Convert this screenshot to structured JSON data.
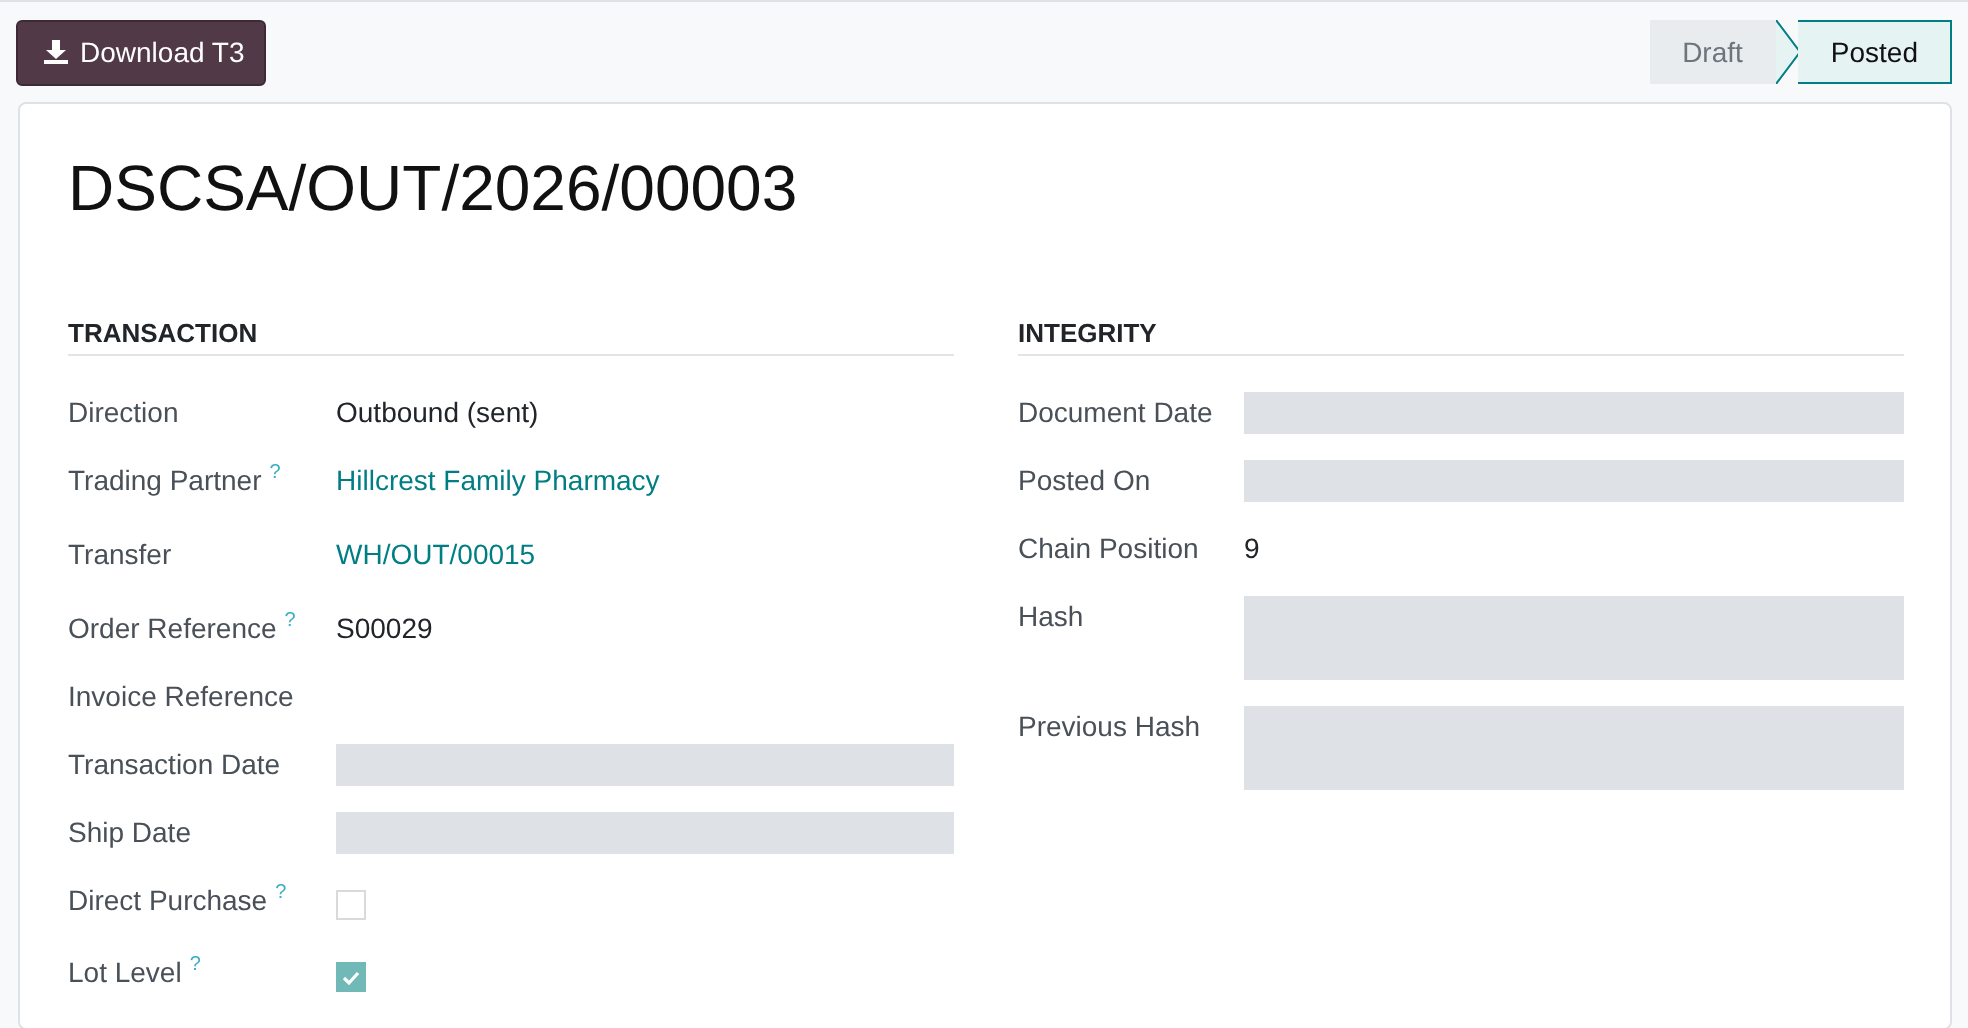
{
  "download_button": {
    "label": "Download T3"
  },
  "status": [
    {
      "label": "Draft",
      "selected": false
    },
    {
      "label": "Posted",
      "selected": true
    }
  ],
  "title": "DSCSA/OUT/2026/00003",
  "sections": [
    {
      "heading": "TRANSACTION",
      "fields": [
        {
          "label": "Direction",
          "kind": "text",
          "value": "Outbound (sent)"
        },
        {
          "label": "Trading Partner",
          "help": "?",
          "kind": "link",
          "value": "Hillcrest Family Pharmacy"
        },
        {
          "label": "Transfer",
          "kind": "link",
          "value": "WH/OUT/00015"
        },
        {
          "label": "Order Reference",
          "help": "?",
          "kind": "text",
          "value": "S00029"
        },
        {
          "label": "Invoice Reference",
          "kind": "empty"
        },
        {
          "label": "Transaction Date",
          "kind": "blank"
        },
        {
          "label": "Ship Date",
          "kind": "blank"
        },
        {
          "label": "Direct Purchase",
          "help": "?",
          "kind": "checkbox",
          "checked": false
        },
        {
          "label": "Lot Level",
          "help": "?",
          "kind": "checkbox",
          "checked": true
        }
      ]
    },
    {
      "heading": "INTEGRITY",
      "fields": [
        {
          "label": "Document Date",
          "kind": "blank"
        },
        {
          "label": "Posted On",
          "kind": "blank"
        },
        {
          "label": "Chain Position",
          "kind": "text",
          "value": "9"
        },
        {
          "label": "Hash",
          "kind": "tall"
        },
        {
          "label": "Previous Hash",
          "kind": "tall"
        }
      ]
    }
  ]
}
